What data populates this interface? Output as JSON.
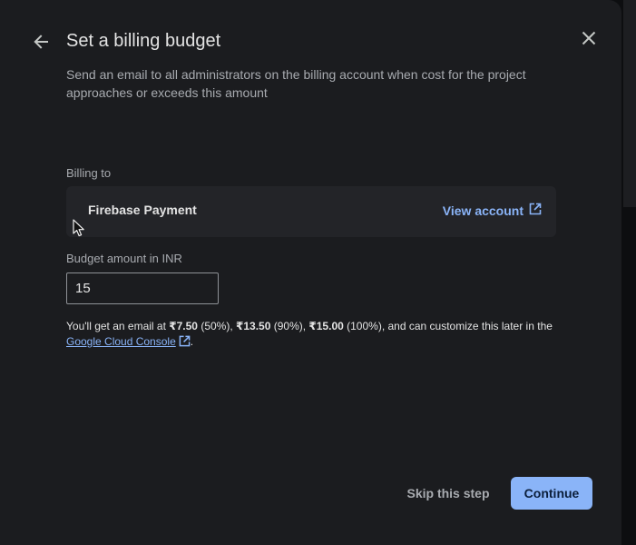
{
  "dialog": {
    "title": "Set a billing budget",
    "description": "Send an email to all administrators on the billing account when cost for the project approaches or exceeds this amount"
  },
  "billing": {
    "label": "Billing to",
    "account_name": "Firebase Payment",
    "view_account_label": "View account"
  },
  "budget": {
    "label": "Budget amount in INR",
    "value": "15"
  },
  "info": {
    "prefix": "You'll get an email at ",
    "amount_1": "₹7.50",
    "pct_1": " (50%), ",
    "amount_2": "₹13.50",
    "pct_2": " (90%), ",
    "amount_3": "₹15.00",
    "pct_3": " (100%), and can customize this later in the ",
    "link_text": "Google Cloud Console",
    "suffix": "."
  },
  "actions": {
    "skip_label": "Skip this step",
    "continue_label": "Continue"
  },
  "colors": {
    "accent": "#8ab4f8",
    "surface": "#1b1c1f",
    "card": "#232428"
  },
  "icons": {
    "back": "arrow-left-icon",
    "close": "close-icon",
    "external": "external-link-icon",
    "cursor": "mouse-pointer-icon"
  }
}
